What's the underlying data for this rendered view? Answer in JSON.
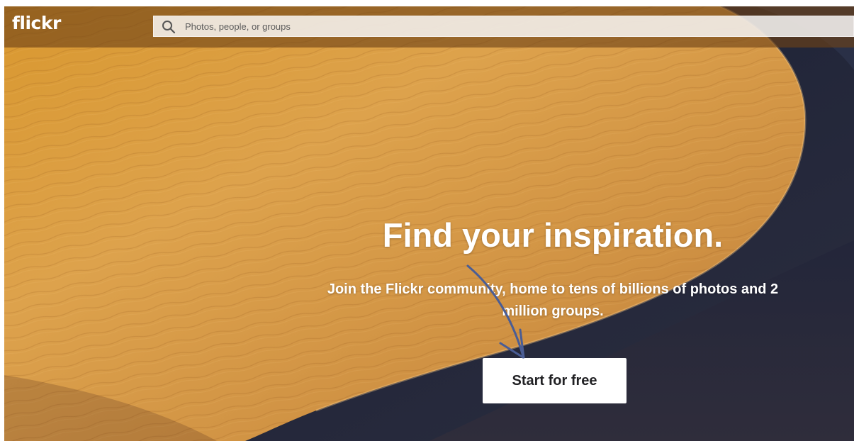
{
  "header": {
    "logo": "flickr",
    "search_placeholder": "Photos, people, or groups"
  },
  "hero": {
    "headline": "Find your inspiration.",
    "subheadline": "Join the Flickr community, home to tens of billions of photos and 2 million groups.",
    "cta_label": "Start for free",
    "background": "sand-dune-photo"
  },
  "colors": {
    "sand": "#c98a35",
    "sand_highlight": "#e2a95a",
    "shadow": "#1d2133",
    "header_overlay": "#6e4216",
    "annotation_arrow": "#4a5d95"
  },
  "icons": {
    "search": "search-icon",
    "annotation": "arrow-icon"
  }
}
